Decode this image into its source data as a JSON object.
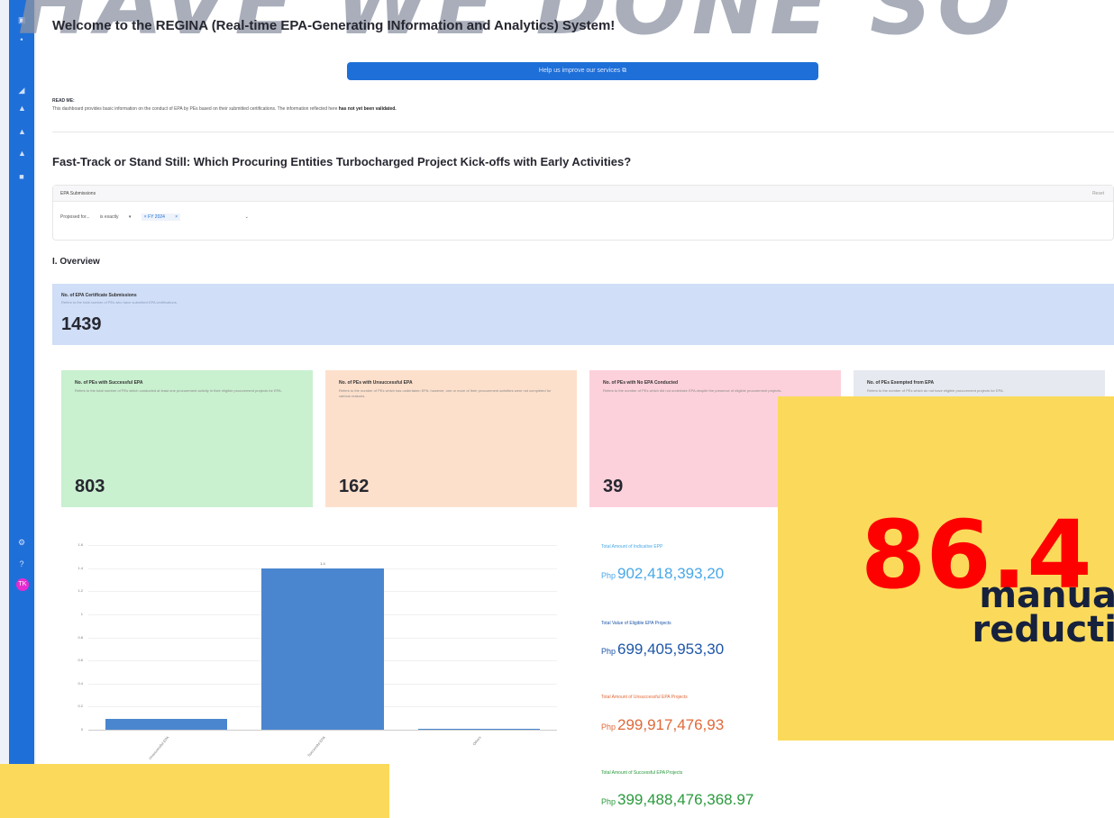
{
  "overlay": {
    "headline": "HAVE WE DONE SO",
    "big_stat": "86.4",
    "caption_line1": "manua",
    "caption_line2": "reducti"
  },
  "sidebar": {
    "avatar_text": "TK"
  },
  "page": {
    "welcome_title": "Welcome to the REGINA (Real-time EPA-Generating INformation and Analytics) System!",
    "help_button": "Help us improve our services",
    "readme_title": "READ ME:",
    "readme_text": "This dashboard provides basic information on the conduct of EPA by PEs based on their submitted certifications. The information reflected here",
    "readme_bold": "has not yet been validated.",
    "section_title": "Fast-Track or Stand Still: Which Procuring Entities Turbocharged Project Kick-offs with Early Activities?"
  },
  "filter": {
    "header_label": "EPA Submissions",
    "reset_label": "Reset",
    "field": "Proposed for...",
    "operator": "is exactly",
    "value_chip": "FY 2024"
  },
  "overview": {
    "title": "I. Overview",
    "big_card": {
      "title": "No. of EPA Certificate Submissions",
      "desc": "Refers to the total number of PEs who have submitted EPA certifications.",
      "value": "1439"
    },
    "cards": [
      {
        "title": "No. of PEs with Successful EPA",
        "desc": "Refers to the total number of PEs which conducted at least one procurement activity in their eligible procurement projects for EPA.",
        "value": "803",
        "color": "#c9f0cf"
      },
      {
        "title": "No. of PEs with Unsuccessful EPA",
        "desc": "Refers to the number of PEs which has undertaken EPA; however, one or more of their procurement activities were not completed for various reasons.",
        "value": "162",
        "color": "#fde0cc"
      },
      {
        "title": "No. of PEs with No EPA Conducted",
        "desc": "Refers to the number of PEs which did not undertake EPA despite the presence of eligible procurement projects.",
        "value": "39",
        "color": "#fcd1db"
      },
      {
        "title": "No. of PEs Exempted from EPA",
        "desc": "Refers to the number of PEs which do not have eligible procurement projects for EPA.",
        "value": "",
        "color": "#e6e9ef"
      }
    ]
  },
  "chart_data": {
    "type": "bar",
    "categories": [
      "Unsuccessful EPA",
      "Successful EPA",
      "Others"
    ],
    "values": [
      0.09,
      1.4,
      0.005
    ],
    "ylim": [
      0,
      1.6
    ],
    "yticks": [
      "0",
      "0.2",
      "0.4",
      "0.6",
      "0.8",
      "1",
      "1.2",
      "1.4",
      "1.6"
    ],
    "bar_labels": [
      "",
      "1.4",
      ""
    ],
    "color": "#4a86cf"
  },
  "amounts": [
    {
      "label": "Total Amount of Indicative EPP",
      "currency": "Php",
      "value": "902,418,393,20",
      "color": "#4aa8e8"
    },
    {
      "label": "Total Value of Eligible EPA Projects",
      "currency": "Php",
      "value": "699,405,953,30",
      "color": "#1e56a8"
    },
    {
      "label": "Total Amount of Unsuccessful EPA Projects",
      "currency": "Php",
      "value": "299,917,476,93",
      "color": "#e0693a"
    },
    {
      "label": "Total Amount of Successful EPA Projects",
      "currency": "Php",
      "value": "399,488,476,368.97",
      "color": "#2a9a3c"
    }
  ]
}
